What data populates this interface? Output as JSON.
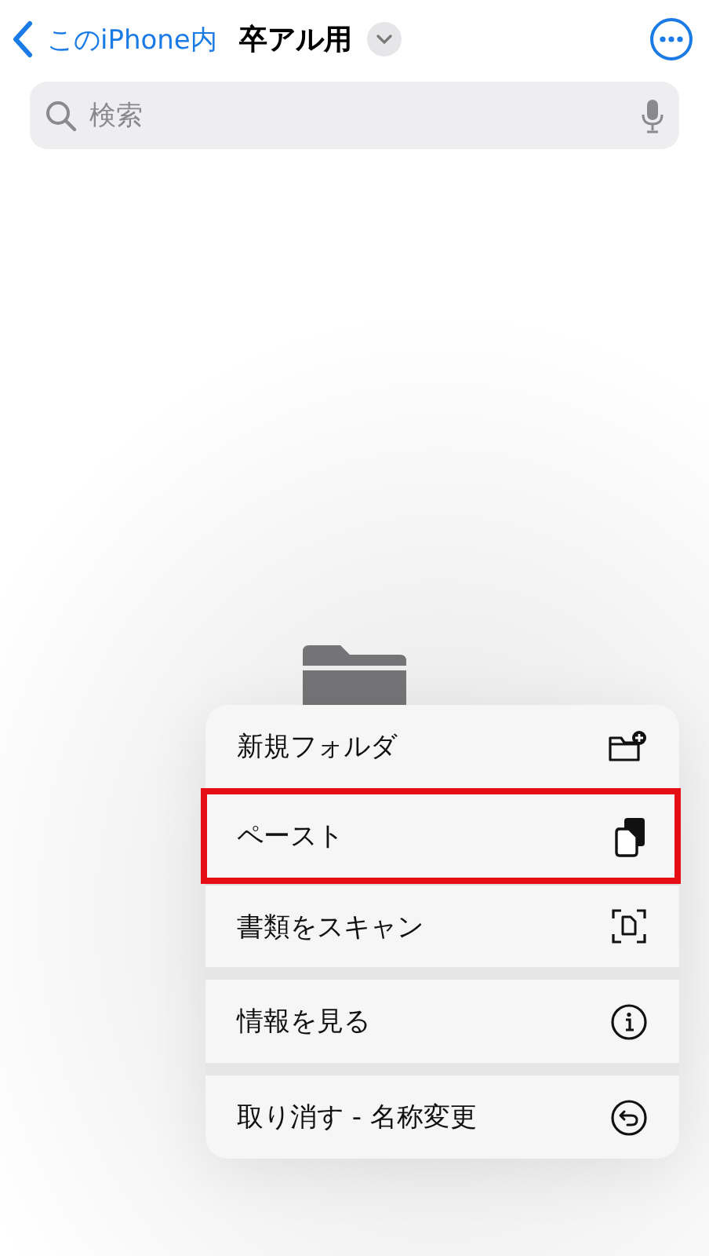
{
  "nav": {
    "back_label": "このiPhone内",
    "title": "卒アル用"
  },
  "search": {
    "placeholder": "検索"
  },
  "context_menu": {
    "groups": [
      {
        "items": [
          {
            "label": "新規フォルダ",
            "kind": "new-folder",
            "highlighted": false
          },
          {
            "label": "ペースト",
            "kind": "paste",
            "highlighted": true
          },
          {
            "label": "書類をスキャン",
            "kind": "scan",
            "highlighted": false
          }
        ]
      },
      {
        "items": [
          {
            "label": "情報を見る",
            "kind": "info",
            "highlighted": false
          }
        ]
      },
      {
        "items": [
          {
            "label": "取り消す - 名称変更",
            "kind": "undo",
            "highlighted": false
          }
        ]
      }
    ]
  }
}
